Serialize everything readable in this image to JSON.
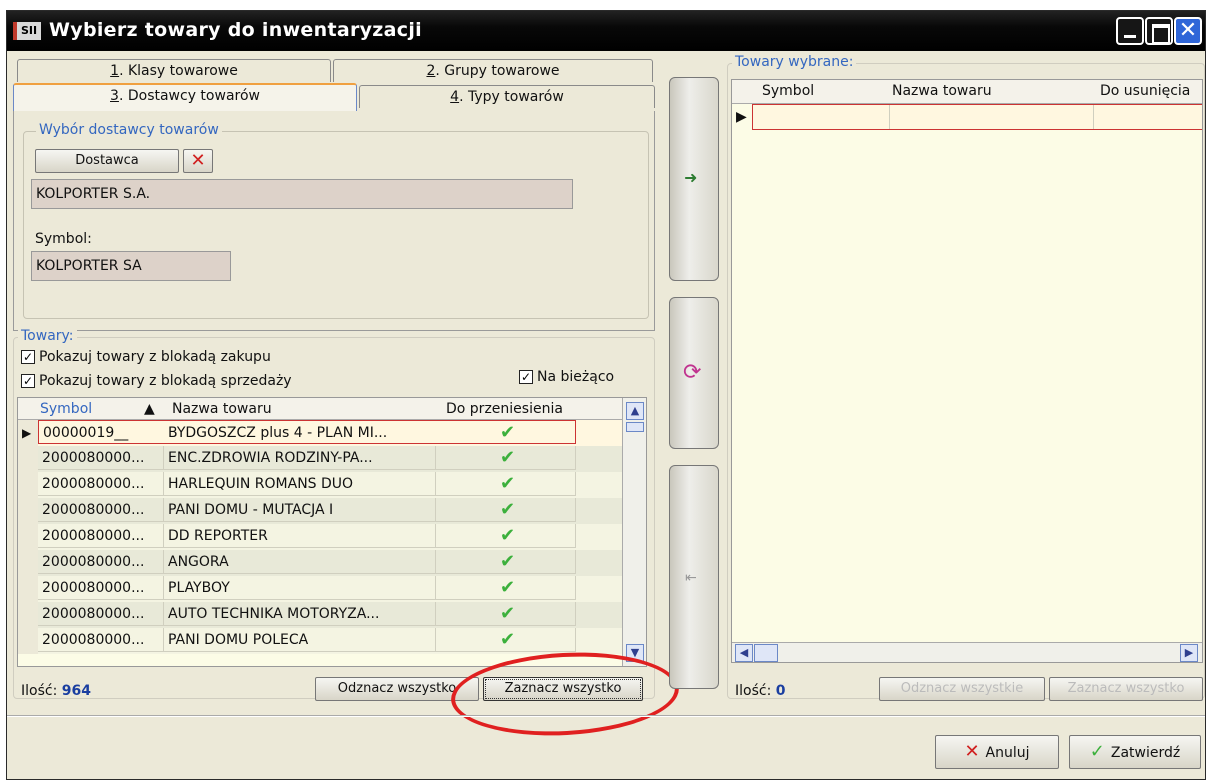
{
  "window": {
    "title": "Wybierz towary do inwentaryzacji",
    "app_icon": "SII"
  },
  "tabs": [
    {
      "label": "Klasy towarowe",
      "num": "1"
    },
    {
      "label": "Grupy towarowe",
      "num": "2"
    },
    {
      "label": "Dostawcy towarów",
      "num": "3"
    },
    {
      "label": "Typy towarów",
      "num": "4"
    }
  ],
  "supplier": {
    "group_title": "Wybór dostawcy towarów",
    "button_label": "Dostawca",
    "name_value": "KOLPORTER S.A.",
    "symbol_label": "Symbol:",
    "symbol_value": "KOLPORTER SA"
  },
  "towary": {
    "group_title": "Towary:",
    "chk_zakupu": "Pokazuj towary z blokadą zakupu",
    "chk_sprzedazy": "Pokazuj towary z blokadą sprzedaży",
    "chk_biezaco": "Na bieżąco",
    "columns": [
      "Symbol",
      "Nazwa towaru",
      "Do przeniesienia"
    ],
    "rows": [
      {
        "symbol": "00000019__",
        "name": "BYDGOSZCZ plus 4 - PLAN MI..."
      },
      {
        "symbol": "2000080000...",
        "name": "ENC.ZDROWIA RODZINY-PA..."
      },
      {
        "symbol": "2000080000...",
        "name": "HARLEQUIN ROMANS DUO"
      },
      {
        "symbol": "2000080000...",
        "name": "PANI DOMU - MUTACJA I"
      },
      {
        "symbol": "2000080000...",
        "name": "DD REPORTER"
      },
      {
        "symbol": "2000080000...",
        "name": "ANGORA"
      },
      {
        "symbol": "2000080000...",
        "name": "PLAYBOY"
      },
      {
        "symbol": "2000080000...",
        "name": "AUTO TECHNIKA MOTORYZA..."
      },
      {
        "symbol": "2000080000...",
        "name": "PANI DOMU POLECA"
      }
    ],
    "count_label": "Ilość:",
    "count_value": "964",
    "unselect_all": "Odznacz wszystko",
    "select_all": "Zaznacz wszystko"
  },
  "selected": {
    "group_title": "Towary wybrane:",
    "columns": [
      "Symbol",
      "Nazwa towaru",
      "Do usunięcia"
    ],
    "count_label": "Ilość:",
    "count_value": "0",
    "unselect_all": "Odznacz wszystkie",
    "select_all": "Zaznacz wszystko"
  },
  "footer": {
    "cancel": "Anuluj",
    "confirm": "Zatwierdź"
  },
  "colors": {
    "accent": "#3467c0",
    "grid_bg": "#fcfce6",
    "selection_border": "#cc3333",
    "annotation": "#e02020"
  }
}
